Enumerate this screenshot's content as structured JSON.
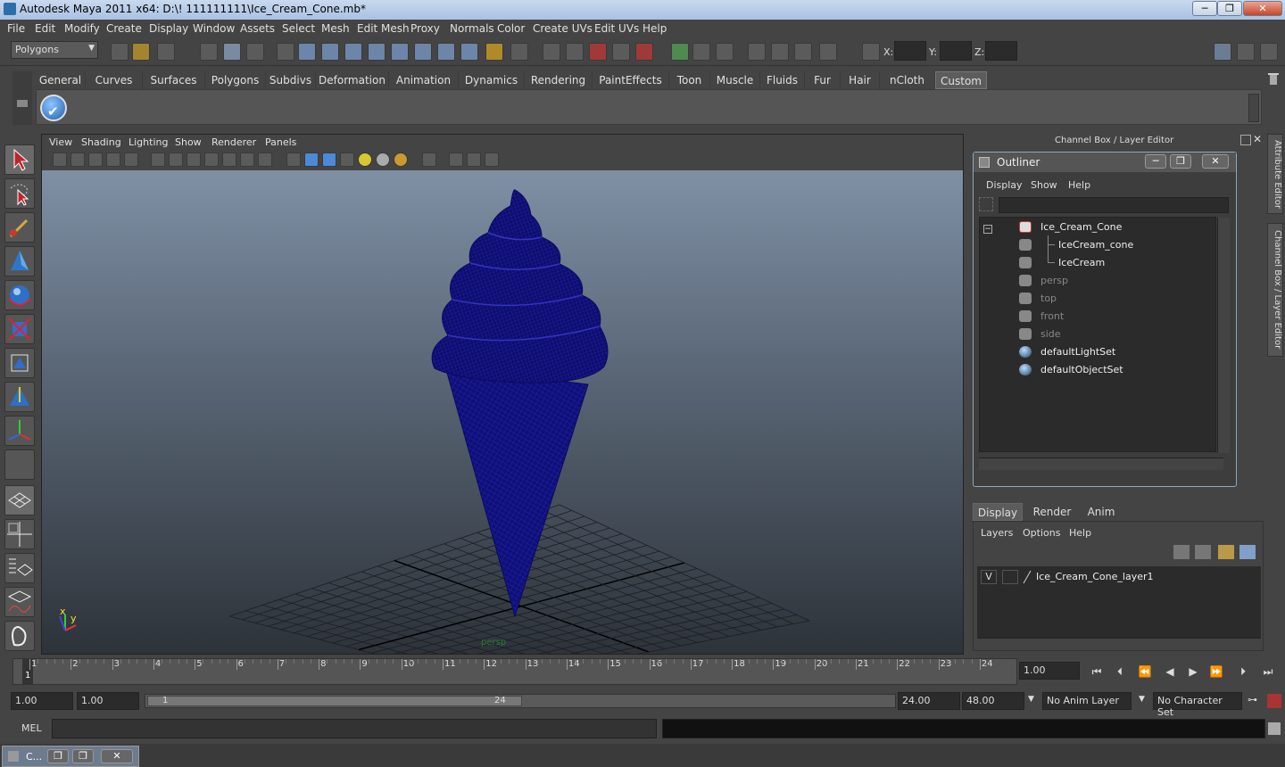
{
  "window": {
    "title": "Autodesk Maya 2011 x64: D:\\! 111111111\\Ice_Cream_Cone.mb*",
    "minimize": "─",
    "maximize": "❐",
    "close": "✕"
  },
  "menubar": [
    "File",
    "Edit",
    "Modify",
    "Create",
    "Display",
    "Window",
    "Assets",
    "Select",
    "Mesh",
    "Edit Mesh",
    "Proxy",
    "Normals",
    "Color",
    "Create UVs",
    "Edit UVs",
    "Help"
  ],
  "statusline": {
    "mode": "Polygons",
    "x_label": "X:",
    "y_label": "Y:",
    "z_label": "Z:"
  },
  "shelf": {
    "tabs": [
      "General",
      "Curves",
      "Surfaces",
      "Polygons",
      "Subdivs",
      "Deformation",
      "Animation",
      "Dynamics",
      "Rendering",
      "PaintEffects",
      "Toon",
      "Muscle",
      "Fluids",
      "Fur",
      "Hair",
      "nCloth",
      "Custom"
    ],
    "active": "Custom"
  },
  "viewport": {
    "menu": [
      "View",
      "Shading",
      "Lighting",
      "Show",
      "Renderer",
      "Panels"
    ],
    "camera_label": "persp",
    "axis_y": "y",
    "axis_x": "x"
  },
  "channelbox": {
    "header": "Channel Box / Layer Editor"
  },
  "outliner": {
    "title": "Outliner",
    "menu": [
      "Display",
      "Show",
      "Help"
    ],
    "items": [
      {
        "label": "Ice_Cream_Cone",
        "dim": false
      },
      {
        "label": "IceCream_cone",
        "dim": false
      },
      {
        "label": "IceCream",
        "dim": false
      },
      {
        "label": "persp",
        "dim": true
      },
      {
        "label": "top",
        "dim": true
      },
      {
        "label": "front",
        "dim": true
      },
      {
        "label": "side",
        "dim": true
      },
      {
        "label": "defaultLightSet",
        "dim": false
      },
      {
        "label": "defaultObjectSet",
        "dim": false
      }
    ]
  },
  "layereditor": {
    "tabs": [
      "Display",
      "Render",
      "Anim"
    ],
    "active": "Display",
    "menu": [
      "Layers",
      "Options",
      "Help"
    ],
    "layer": {
      "visible": "V",
      "name": "Ice_Cream_Cone_layer1"
    }
  },
  "sidetabs": [
    "Attribute Editor",
    "Channel Box / Layer Editor"
  ],
  "timeslider": {
    "ticks": [
      "1",
      "2",
      "3",
      "4",
      "5",
      "6",
      "7",
      "8",
      "9",
      "10",
      "11",
      "12",
      "13",
      "14",
      "15",
      "16",
      "17",
      "18",
      "19",
      "20",
      "21",
      "22",
      "23",
      "24"
    ],
    "current": "1",
    "current_time": "1.00"
  },
  "rangeslider": {
    "start_time": "1.00",
    "range_start": "1.00",
    "range_inner_start": "1",
    "range_inner_end": "24",
    "range_end": "24.00",
    "end_time": "48.00",
    "anim_layer": "No Anim Layer",
    "character_set": "No Character Set"
  },
  "cmdline": {
    "label": "MEL"
  },
  "taskbar": {
    "label": "C..."
  },
  "colors": {
    "mesh": "#0c0c78",
    "grid": "#1b1e24",
    "accent": "#5c5c5c"
  }
}
